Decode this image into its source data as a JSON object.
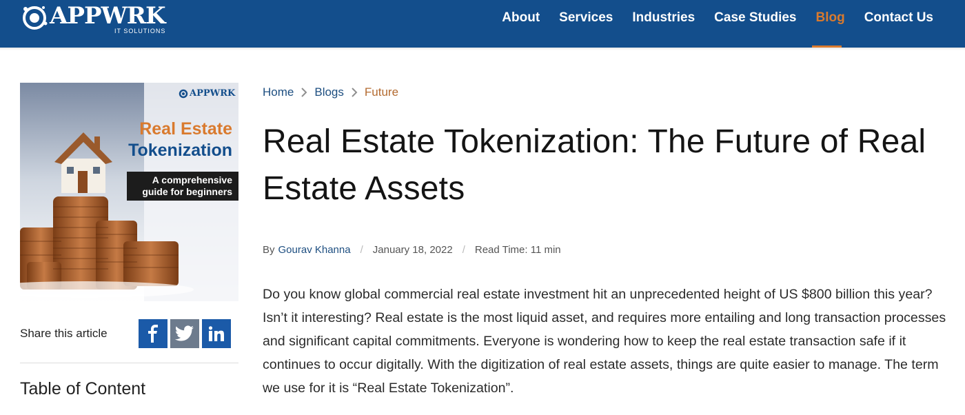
{
  "header": {
    "logo_text": "APPWRK",
    "logo_subtext": "IT SOLUTIONS",
    "nav": [
      {
        "label": "About"
      },
      {
        "label": "Services"
      },
      {
        "label": "Industries"
      },
      {
        "label": "Case Studies"
      },
      {
        "label": "Blog",
        "active": true
      },
      {
        "label": "Contact Us"
      }
    ]
  },
  "hero_image": {
    "brand": "APPWRK",
    "title_line1": "Real Estate",
    "title_line2": "Tokenization",
    "tag_line1": "A comprehensive",
    "tag_line2": "guide for beginners"
  },
  "share": {
    "label": "Share this article",
    "icons": [
      "facebook-icon",
      "twitter-icon",
      "linkedin-icon"
    ]
  },
  "toc": {
    "title": "Table of Content"
  },
  "breadcrumb": [
    "Home",
    "Blogs",
    "Future"
  ],
  "article": {
    "title": "Real Estate Tokenization: The Future of Real Estate Assets",
    "by_label": "By",
    "author": "Gourav Khanna",
    "date": "January 18, 2022",
    "read_time": "Read Time: 11 min",
    "body": "Do you know global commercial real estate investment hit an unprecedented height of US $800 billion this year? Isn’t it interesting? Real estate is the most liquid asset, and requires more entailing and long transaction processes and significant capital commitments. Everyone is wondering how to keep the real estate transaction safe if it continues to occur digitally. With the digitization of real estate assets, things are quite easier to manage. The term we use for it is “Real Estate Tokenization”."
  },
  "colors": {
    "header_bg": "#134e8c",
    "accent": "#d97a2e",
    "link": "#1d4e80",
    "facebook": "#1b5aa8",
    "twitter": "#6d7b8d",
    "linkedin": "#1b5aa8"
  }
}
